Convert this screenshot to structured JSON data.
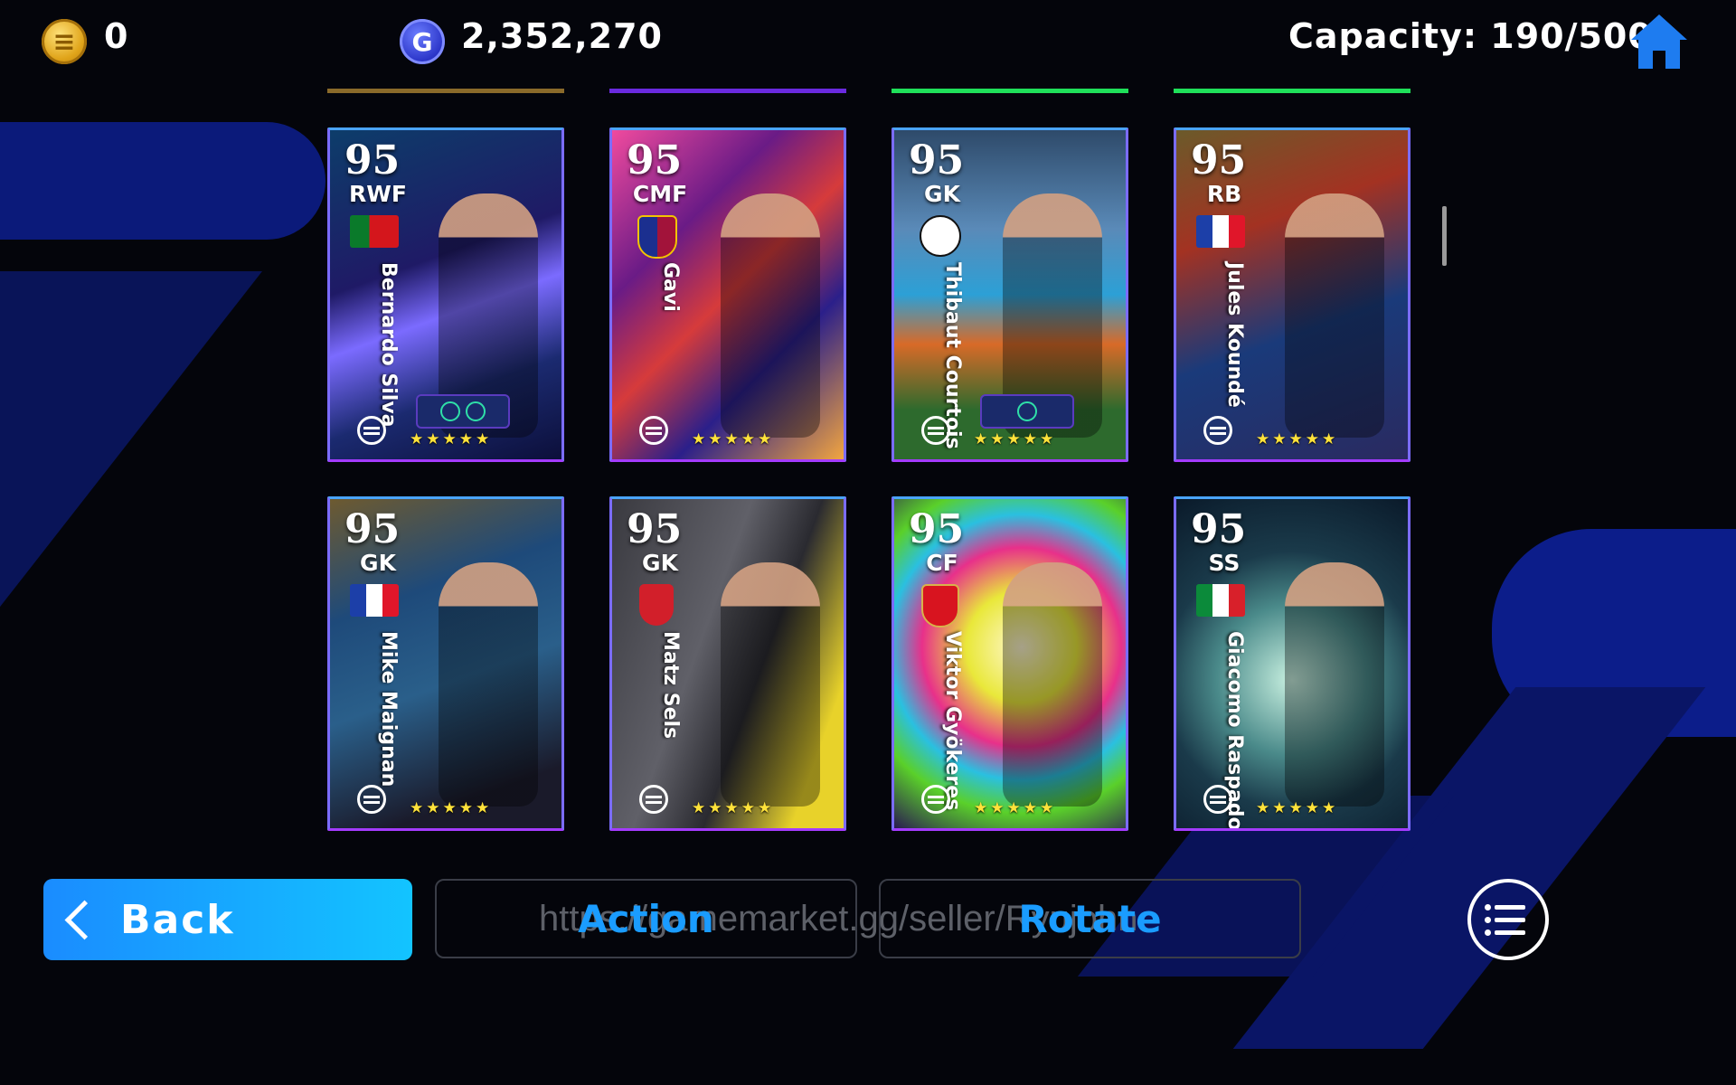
{
  "topbar": {
    "coin_value": "0",
    "gp_value": "2,352,270",
    "capacity": "Capacity: 190/500"
  },
  "cards": [
    {
      "rating": "95",
      "position": "RWF",
      "name": "Bernardo Silva",
      "stars": "★★★★★",
      "badge": "flag-pt",
      "art": "linear-gradient(160deg,#0d3d6a,#1f1a66 40%,#7b6bff 55%,#1b2a70 75%,#0c0f3a)"
    },
    {
      "rating": "95",
      "position": "CMF",
      "name": "Gavi",
      "stars": "★★★★★",
      "badge": "crest-barca",
      "art": "linear-gradient(135deg,#f04a9e,#6a1b86 30%,#d63b3b 50%,#2b1f8a 70%,#f2a540)"
    },
    {
      "rating": "95",
      "position": "GK",
      "name": "Thibaut Courtois",
      "stars": "★★★★★",
      "badge": "crest-brugge",
      "art": "linear-gradient(180deg,#2e4a6a,#5a8ab8 30%,#2ca0d6 50%,#d86a28 65%,#2d6a2d 85%)"
    },
    {
      "rating": "95",
      "position": "RB",
      "name": "Jules Koundé",
      "stars": "★★★★★",
      "badge": "flag-fr",
      "art": "linear-gradient(160deg,#6b5a2a,#a33222 30%,#1a3a7a 60%,#2a2a60)"
    },
    {
      "rating": "95",
      "position": "GK",
      "name": "Mike Maignan",
      "stars": "★★★★★",
      "badge": "flag-fr",
      "art": "linear-gradient(160deg,#6d5a30,#1e4a7a 30%,#2a5f8a 55%,#1a1a2a 85%)"
    },
    {
      "rating": "95",
      "position": "GK",
      "name": "Matz Sels",
      "stars": "★★★★★",
      "badge": "crest-nor",
      "art": "linear-gradient(110deg,#3a3a40,#606068 40%,#2a2a30 60%,#e8d22a 85%)"
    },
    {
      "rating": "95",
      "position": "CF",
      "name": "Viktor Gyökeres",
      "stars": "★★★★★",
      "badge": "crest-ars",
      "art": "radial-gradient(circle at 55% 45%,#fff7d0,#e9e83a 25%,#e8308a 45%,#2ac0e0 60%,#5ad02a 75%,#2a1a50)"
    },
    {
      "rating": "95",
      "position": "SS",
      "name": "Giacomo Raspadori",
      "stars": "★★★★★",
      "badge": "flag-it",
      "art": "radial-gradient(circle at 50% 55%,#c8f0e0,#4a8a8a 35%,#1a3a4a 60%,#0a1a2a)"
    }
  ],
  "edges": [
    "#8a6a2a",
    "#6a2adf",
    "#1fe05a",
    "#1fe05a"
  ],
  "buttons": {
    "back": "Back",
    "action": "Action",
    "rotate": "Rotate"
  },
  "watermark": "https://gamemarket.gg/seller/Ryujohn",
  "icons": [
    "coin-icon",
    "gp-icon",
    "home-icon",
    "chevron-left-icon",
    "menu-list-icon"
  ]
}
